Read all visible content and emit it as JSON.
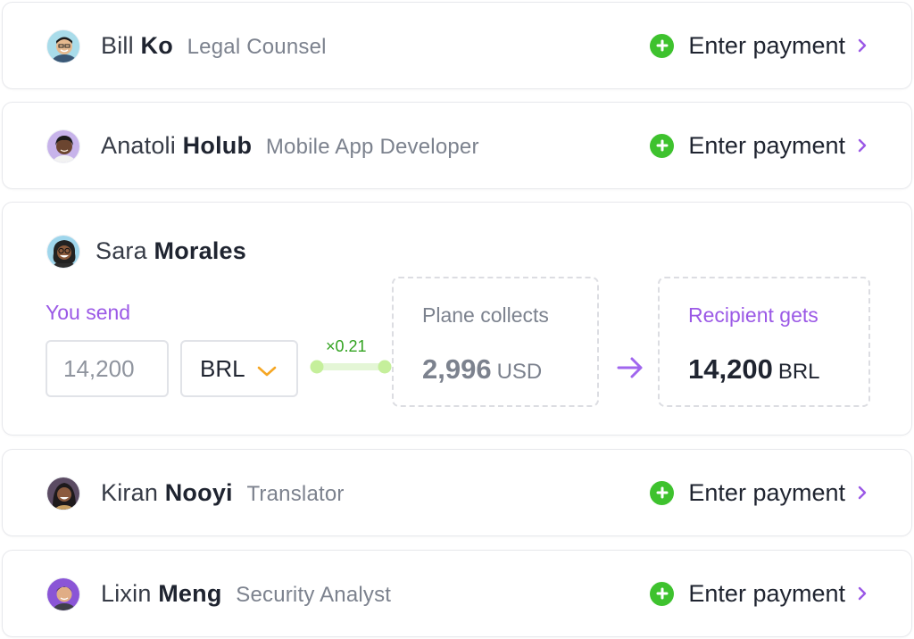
{
  "recipients_top": [
    {
      "first": "Bill",
      "last": "Ko",
      "title": "Legal Counsel",
      "action": "Enter payment",
      "avatar": "avatar-bill-ko"
    },
    {
      "first": "Anatoli",
      "last": "Holub",
      "title": "Mobile App Developer",
      "action": "Enter payment",
      "avatar": "avatar-anatoli-holub"
    }
  ],
  "expanded": {
    "first": "Sara",
    "last": "Morales",
    "you_send_label": "You send",
    "amount": "14,200",
    "currency": "BRL",
    "rate": "×0.21",
    "plane_collects_label": "Plane collects",
    "plane_amount": "2,996",
    "plane_currency": "USD",
    "recipient_gets_label": "Recipient gets",
    "recipient_amount": "14,200",
    "recipient_currency": "BRL"
  },
  "recipients_bottom": [
    {
      "first": "Kiran",
      "last": "Nooyi",
      "title": "Translator",
      "action": "Enter payment",
      "avatar": "avatar-kiran-nooyi"
    },
    {
      "first": "Lixin",
      "last": "Meng",
      "title": "Security Analyst",
      "action": "Enter payment",
      "avatar": "avatar-lixin-meng"
    }
  ],
  "colors": {
    "accent_purple": "#9b59e6",
    "plus_green": "#3ec22e",
    "rate_green": "#c9f0a6",
    "chevron_orange": "#f5a623",
    "border": "#e7e8ec"
  },
  "icons": [
    "plus-circle-icon",
    "chevron-right-icon",
    "chevron-down-icon",
    "arrow-right-icon"
  ]
}
